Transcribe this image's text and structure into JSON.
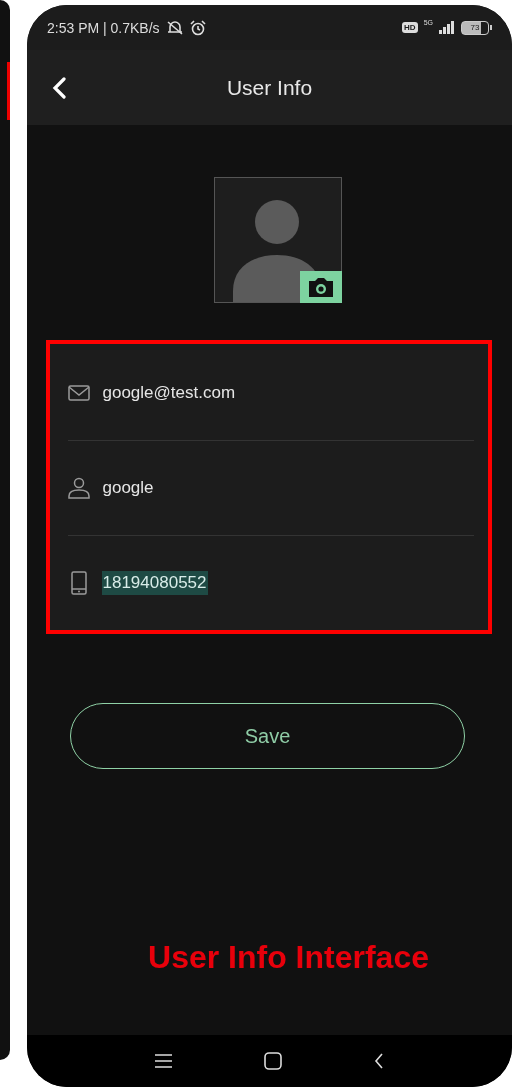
{
  "status_bar": {
    "time_speed": "2:53 PM | 0.7KB/s",
    "hd_badge": "HD",
    "network": "5G",
    "battery": "73"
  },
  "header": {
    "title": "User Info"
  },
  "fields": [
    {
      "kind": "email",
      "value": "google@test.com",
      "selected": false
    },
    {
      "kind": "user",
      "value": "google",
      "selected": false
    },
    {
      "kind": "phone",
      "value": "18194080552",
      "selected": true
    }
  ],
  "save_button": "Save",
  "caption": "User Info Interface"
}
